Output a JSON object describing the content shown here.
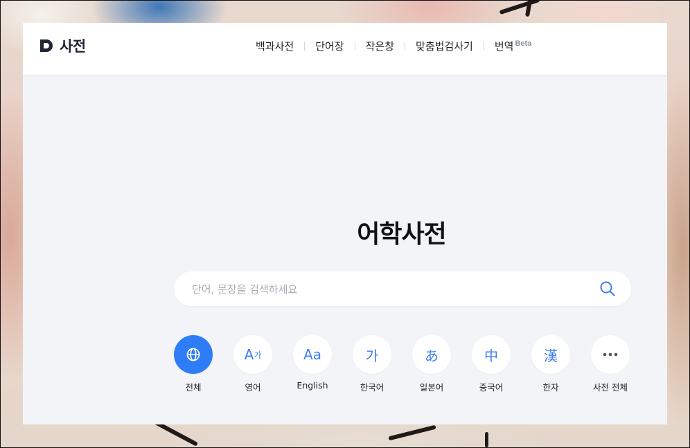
{
  "header": {
    "logo_text": "사전",
    "nav": [
      {
        "label": "백과사전"
      },
      {
        "label": "단어장"
      },
      {
        "label": "작은창"
      },
      {
        "label": "맞춤법검사기"
      },
      {
        "label": "번역",
        "badge": "Beta"
      }
    ]
  },
  "main": {
    "title": "어학사전",
    "search": {
      "placeholder": "단어, 문장을 검색하세요",
      "value": ""
    },
    "categories": [
      {
        "label": "전체",
        "icon": "globe-icon",
        "active": true
      },
      {
        "label": "영어",
        "icon_text": "A",
        "icon_sub": "가"
      },
      {
        "label": "English",
        "icon_text": "Aa"
      },
      {
        "label": "한국어",
        "icon_text": "가"
      },
      {
        "label": "일본어",
        "icon_text": "あ"
      },
      {
        "label": "중국어",
        "icon_text": "中"
      },
      {
        "label": "한자",
        "icon_text": "漢"
      },
      {
        "label": "사전 전체",
        "icon": "more-icon"
      }
    ]
  },
  "colors": {
    "accent": "#2f7df6",
    "icon_blue": "#3c7ef2",
    "panel_bg": "#f2f4f7",
    "logo": "#1f2533"
  }
}
